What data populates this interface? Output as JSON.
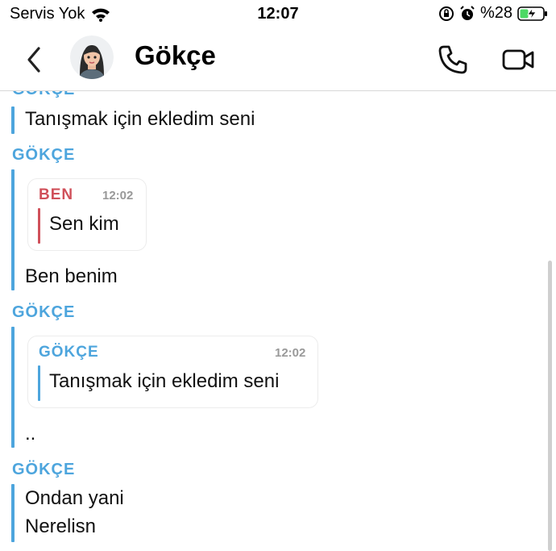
{
  "status_bar": {
    "carrier": "Servis Yok",
    "time": "12:07",
    "battery_percent": "%28"
  },
  "header": {
    "contact_name": "Gökçe"
  },
  "colors": {
    "contact_blue": "#4da5dd",
    "me_red": "#d0505a",
    "battery_green": "#4cd964"
  },
  "chat": {
    "messages": [
      {
        "sender": "GÖKÇE",
        "text": "Tanışmak için ekledim seni"
      },
      {
        "sender": "GÖKÇE",
        "quote": {
          "sender": "BEN",
          "time": "12:02",
          "text": "Sen kim"
        },
        "text": "Ben benim"
      },
      {
        "sender": "GÖKÇE",
        "quote": {
          "sender": "GÖKÇE",
          "time": "12:02",
          "text": "Tanışmak için ekledim seni"
        },
        "text": ".."
      },
      {
        "sender": "GÖKÇE",
        "lines": [
          "Ondan yani",
          "Nerelisn"
        ]
      }
    ]
  }
}
